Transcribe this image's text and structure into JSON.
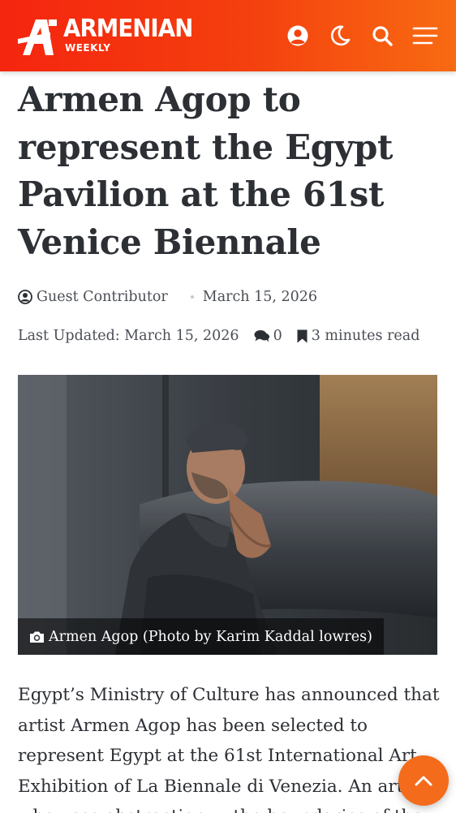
{
  "header": {
    "logo_word": "ARMENIAN",
    "logo_sub": "WEEKLY",
    "icons": [
      "user-icon",
      "moon-icon",
      "search-icon",
      "menu-icon"
    ],
    "background_color": "#f5250f",
    "accent_color": "#f86b12"
  },
  "article": {
    "title": "Armen Agop to represent the Egypt Pavilion at the 61st Venice Biennale",
    "author": "Guest Contributor",
    "date": "March 15, 2026",
    "last_updated": "Last Updated: March 15, 2026",
    "comments": "0",
    "read_time": "3 minutes read",
    "caption": "Armen Agop (Photo by Karim Kaddal lowres)",
    "body": "Egypt’s Ministry of Culture has announced that artist Armen Agop has been selected to represent Egypt at the 61st International Art Exhibition of La Biennale di Venezia. An artist who uses abstraction ... the boundaries of the"
  }
}
